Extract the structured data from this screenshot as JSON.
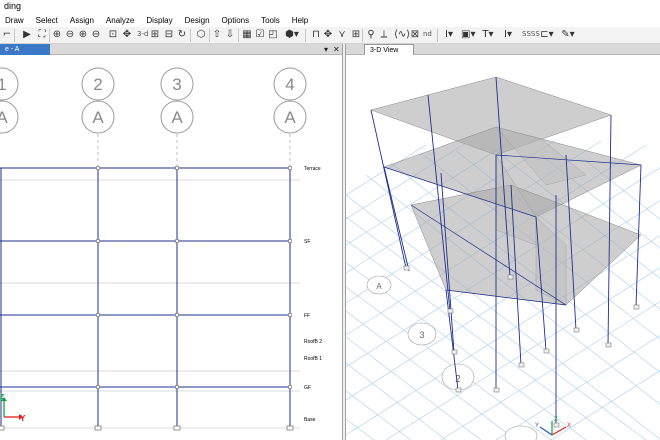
{
  "window": {
    "title": "ding"
  },
  "menu": [
    "Draw",
    "Select",
    "Assign",
    "Analyze",
    "Display",
    "Design",
    "Options",
    "Tools",
    "Help"
  ],
  "toolbar": {
    "nd_label": "nd",
    "sss_label": "SSSS",
    "threed_label": "3-d"
  },
  "left_view": {
    "tab_label": "e - A",
    "grid_lines": [
      {
        "number": "1",
        "letter": "A"
      },
      {
        "number": "2",
        "letter": "A"
      },
      {
        "number": "3",
        "letter": "A"
      },
      {
        "number": "4",
        "letter": "A"
      }
    ],
    "stories": [
      "Terrace",
      "SF",
      "FF",
      "RoofB 2",
      "RoofB 1",
      "GF",
      "Base"
    ],
    "axis": {
      "z": "Z",
      "y": "Y"
    }
  },
  "right_view": {
    "tab_label": "3-D View",
    "floor_labels": [
      "A",
      "3",
      "2"
    ],
    "axis": {
      "z": "Z",
      "x": "X",
      "y": "Y"
    }
  },
  "colors": {
    "frame": "#1f2f8f",
    "slab": "#a6a6a6",
    "grid": "#a9d0ef",
    "tab_active": "#3c78c8"
  }
}
